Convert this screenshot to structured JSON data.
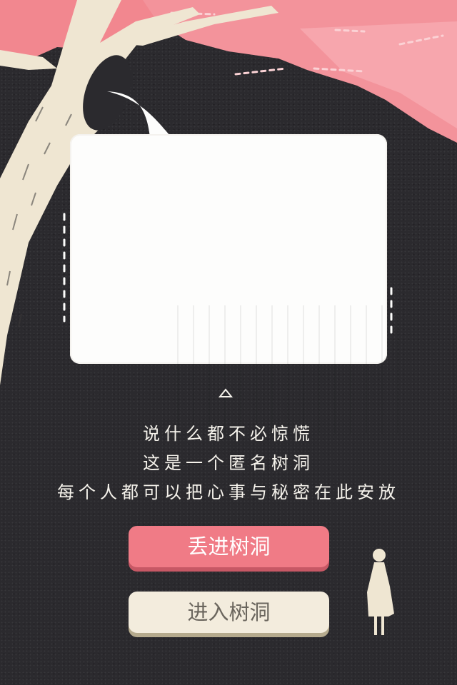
{
  "intro": {
    "line1": "说什么都不必惊慌",
    "line2": "这是一个匿名树洞",
    "line3": "每个人都可以把心事与秘密在此安放"
  },
  "buttons": {
    "throw_label": "丢进树洞",
    "enter_label": "进入树洞"
  },
  "colors": {
    "background": "#2b2a2e",
    "blossom": "#f3909a",
    "trunk": "#efe6d2",
    "throw_button": "#f07b86",
    "enter_button": "#f3ecdd"
  }
}
